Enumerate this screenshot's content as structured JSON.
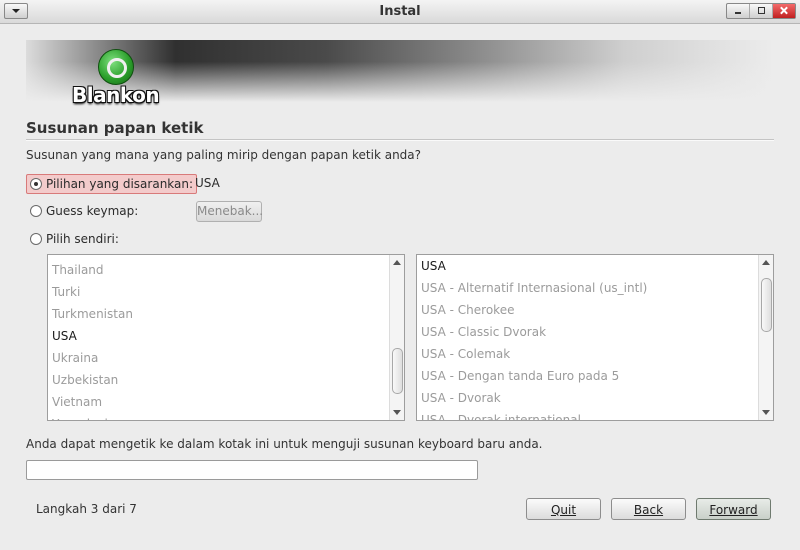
{
  "window": {
    "title": "Instal"
  },
  "brand": {
    "logo_text": "Blankon",
    "logo_color": "#2ca02c"
  },
  "page": {
    "heading": "Susunan papan ketik",
    "question": "Susunan yang mana yang paling mirip dengan papan ketik anda?"
  },
  "options": {
    "suggested_label": "Pilihan yang disarankan:",
    "suggested_value": "USA",
    "guess_label": "Guess keymap:",
    "guess_button": "Menebak...",
    "manual_label": "Pilih sendiri:"
  },
  "countries": {
    "items": [
      "Thailand",
      "Turki",
      "Turkmenistan",
      "USA",
      "Ukraina",
      "Uzbekistan",
      "Vietnam",
      "Yugoslavia"
    ],
    "selected": "USA",
    "scroll_position": 0.85
  },
  "variants": {
    "items": [
      "USA",
      "USA - Alternatif Internasional (us_intl)",
      "USA - Cherokee",
      "USA - Classic Dvorak",
      "USA - Colemak",
      "USA - Dengan tanda Euro pada 5",
      "USA - Dvorak",
      "USA - Dvorak international"
    ],
    "selected": "USA",
    "scroll_position": 0.1
  },
  "test": {
    "hint": "Anda dapat mengetik ke dalam kotak ini untuk menguji susunan keyboard baru anda.",
    "value": ""
  },
  "footer": {
    "step_text": "Langkah 3 dari 7",
    "quit_label": "Quit",
    "back_label": "Back",
    "forward_label": "Forward"
  },
  "colors": {
    "selected_option_bg": "#f3cbcb",
    "selected_option_border": "#d87a7a"
  }
}
